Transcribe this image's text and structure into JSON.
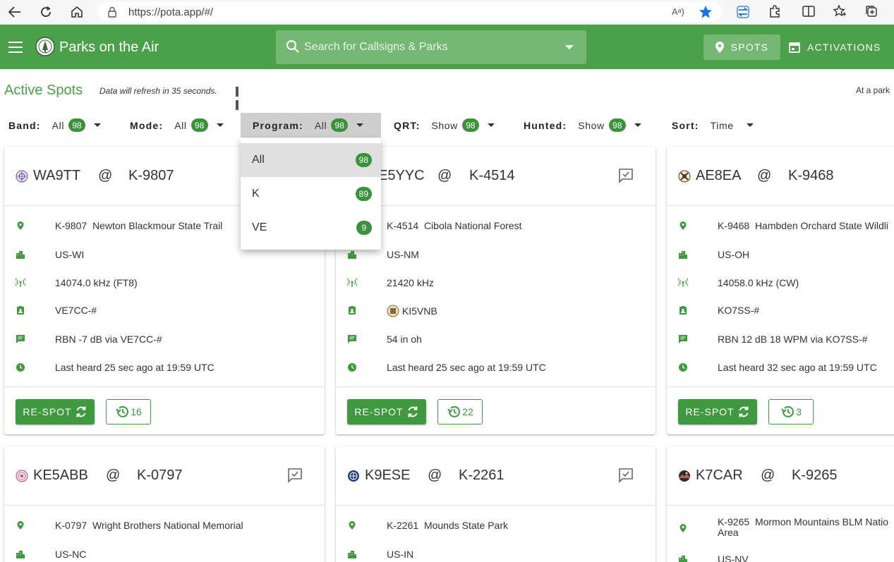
{
  "browser": {
    "url": "https://pota.app/#/",
    "read_aloud": "Aᵃ)"
  },
  "header": {
    "title": "Parks on the Air",
    "search_placeholder": "Search for Callsigns & Parks",
    "spots_label": "SPOTS",
    "activations_label": "ACTIVATIONS"
  },
  "subheader": {
    "title": "Active Spots",
    "refresh": "Data will refresh in 35 seconds.",
    "at_park": "At a park"
  },
  "filters": [
    {
      "label": "Band:",
      "value": "All",
      "count": "98"
    },
    {
      "label": "Mode:",
      "value": "All",
      "count": "98"
    },
    {
      "label": "Program:",
      "value": "All",
      "count": "98"
    },
    {
      "label": "QRT:",
      "value": "Show",
      "count": "98"
    },
    {
      "label": "Hunted:",
      "value": "Show",
      "count": "98"
    },
    {
      "label": "Sort:",
      "value": "Time"
    }
  ],
  "program_dropdown": [
    {
      "label": "All",
      "count": "98"
    },
    {
      "label": "K",
      "count": "89"
    },
    {
      "label": "VE",
      "count": "9"
    }
  ],
  "respot_label": "RE-SPOT",
  "at_sign": "@",
  "cards": [
    {
      "call": "WA9TT",
      "ref": "K-9807",
      "park_ref": "K-9807",
      "park_name": "Newton Blackmour State Trail",
      "location": "US-WI",
      "freq": "14074.0 kHz (FT8)",
      "spotter": "VE7CC-#",
      "comment": "RBN -7 dB via VE7CC-#",
      "heard": "Last heard 25 sec ago at 19:59 UTC",
      "history": "16"
    },
    {
      "call": "E5YYC",
      "ref": "K-4514",
      "park_ref": "K-4514",
      "park_name": "Cibola National Forest",
      "location": "US-NM",
      "freq": "21420 kHz",
      "spotter": "KI5VNB",
      "comment": "54 in oh",
      "heard": "Last heard 25 sec ago at 19:59 UTC",
      "history": "22"
    },
    {
      "call": "AE8EA",
      "ref": "K-9468",
      "park_ref": "K-9468",
      "park_name": "Hambden Orchard State Wildli",
      "location": "US-OH",
      "freq": "14058.0 kHz (CW)",
      "spotter": "KO7SS-#",
      "comment": "RBN 12 dB 18 WPM via KO7SS-#",
      "heard": "Last heard 32 sec ago at 19:59 UTC",
      "history": "3"
    },
    {
      "call": "KE5ABB",
      "ref": "K-0797",
      "park_ref": "K-0797",
      "park_name": "Wright Brothers National Memorial",
      "location": "US-NC"
    },
    {
      "call": "K9ESE",
      "ref": "K-2261",
      "park_ref": "K-2261",
      "park_name": "Mounds State Park",
      "location": "US-IN"
    },
    {
      "call": "K7CAR",
      "ref": "K-9265",
      "park_ref": "K-9265",
      "park_name": "Mormon Mountains BLM Natio",
      "park_name2": "Area",
      "location": "US-NV"
    }
  ],
  "colors": {
    "header_green": "#4aa14a",
    "accent_green": "#3f9a3f"
  }
}
